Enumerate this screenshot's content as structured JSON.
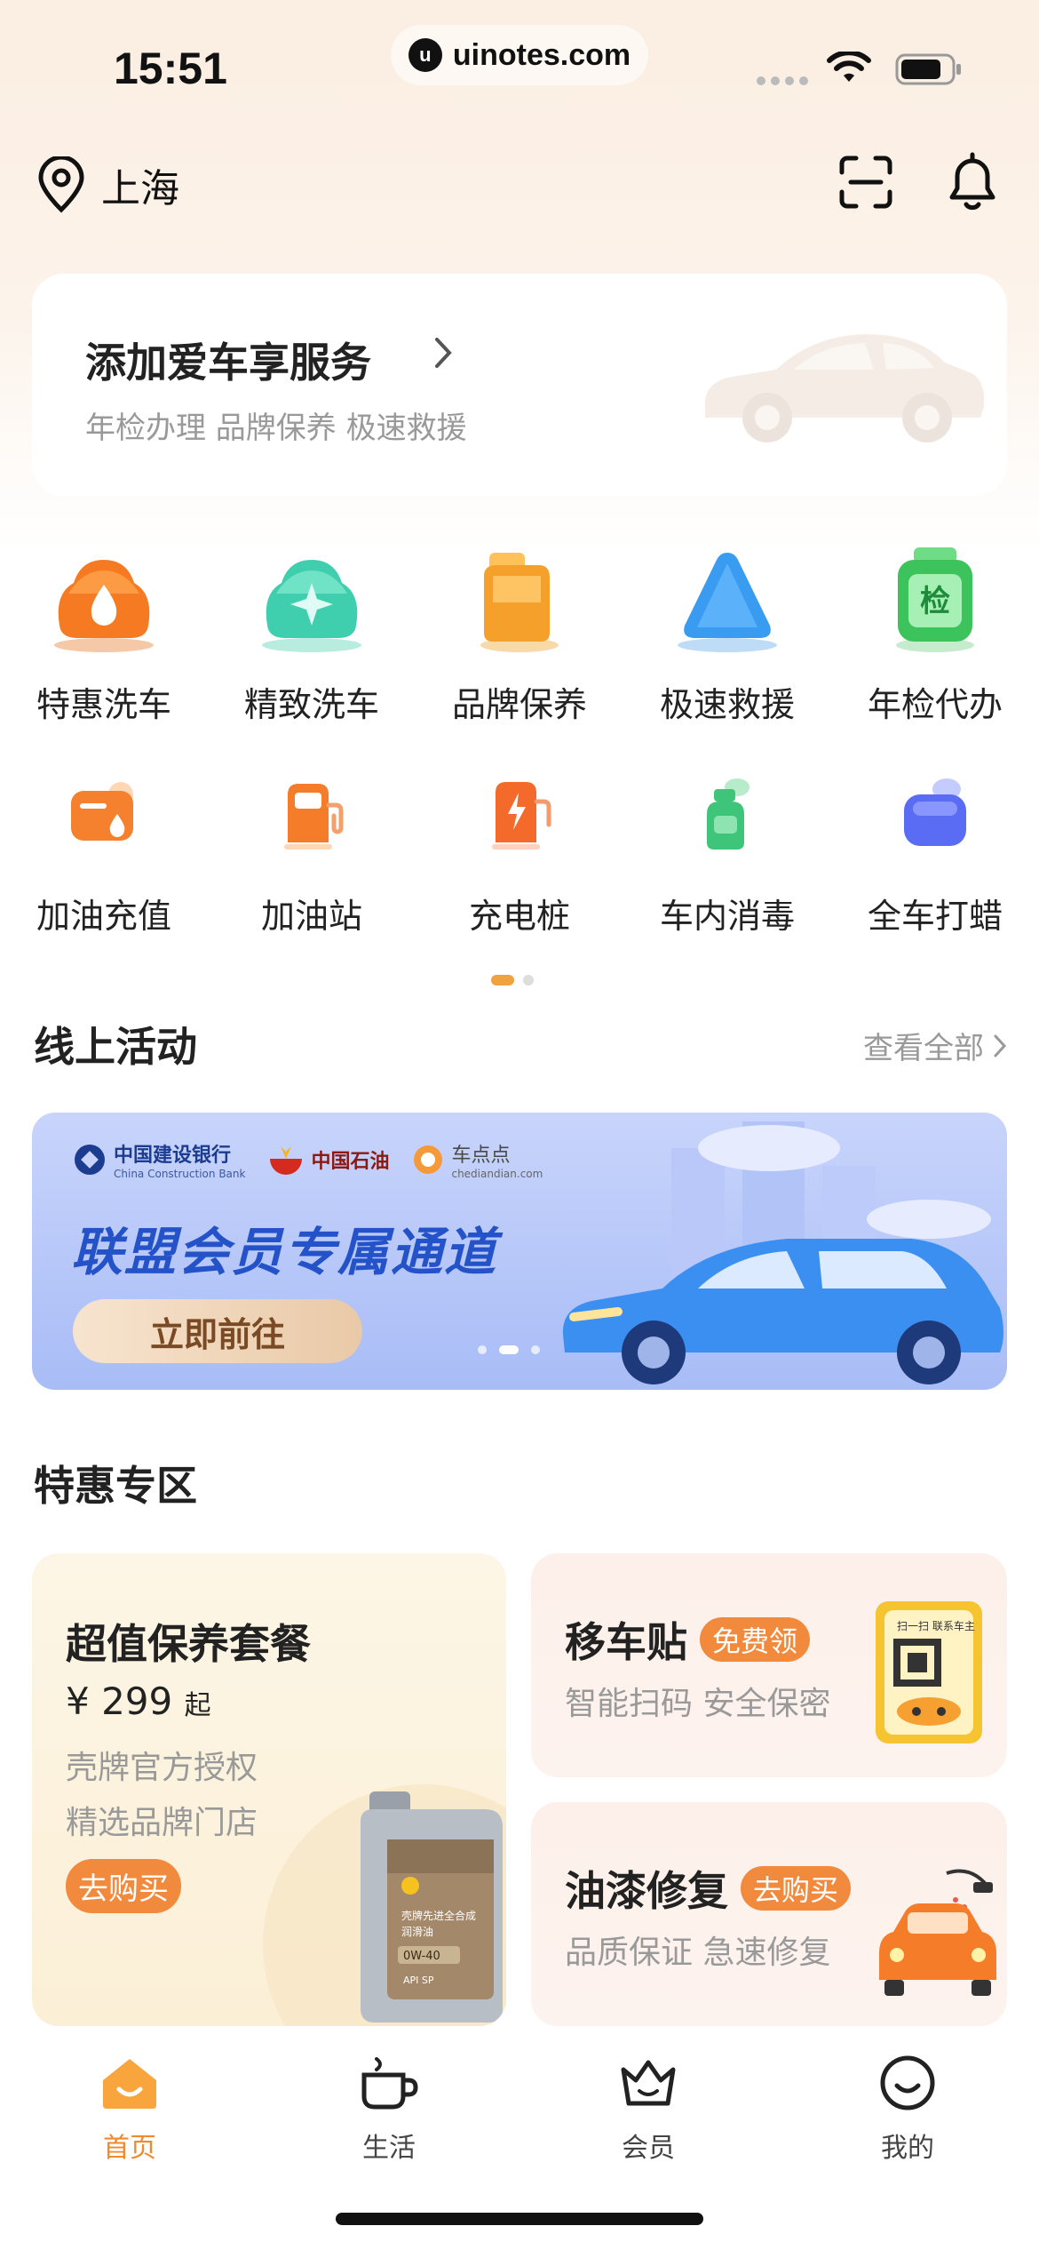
{
  "status_bar": {
    "time": "15:51",
    "url": "uinotes.com",
    "url_logo": "u"
  },
  "header": {
    "location": "上海",
    "icons": [
      "location-pin-icon",
      "scan-icon",
      "bell-icon"
    ]
  },
  "add_car": {
    "title": "添加爱车享服务",
    "subtitle": "年检办理 品牌保养 极速救援"
  },
  "services": {
    "row1": [
      {
        "label": "特惠洗车",
        "icon": "car-wash-drop-icon",
        "color": "#f57a22"
      },
      {
        "label": "精致洗车",
        "icon": "car-sparkle-icon",
        "color": "#3fcfae"
      },
      {
        "label": "品牌保养",
        "icon": "oil-can-icon",
        "color": "#f5a02a"
      },
      {
        "label": "极速救援",
        "icon": "warning-triangle-icon",
        "color": "#3a9cf0"
      },
      {
        "label": "年检代办",
        "icon": "inspection-badge-icon",
        "color": "#3cc35c",
        "badge": "检"
      }
    ],
    "row2": [
      {
        "label": "加油充值",
        "icon": "fuel-card-icon",
        "color": "#f5812e"
      },
      {
        "label": "加油站",
        "icon": "gas-pump-icon",
        "color": "#f57d2a"
      },
      {
        "label": "充电桩",
        "icon": "charging-pile-icon",
        "color": "#f36a2a"
      },
      {
        "label": "车内消毒",
        "icon": "disinfect-spray-icon",
        "color": "#3ec57a"
      },
      {
        "label": "全车打蜡",
        "icon": "wax-polish-icon",
        "color": "#5a6cf3"
      }
    ],
    "page": 1,
    "pages": 2
  },
  "online_activities": {
    "title": "线上活动",
    "see_all": "查看全部",
    "banner": {
      "logos": [
        {
          "name": "中国建设银行",
          "sub": "China Construction Bank"
        },
        {
          "name": "中国石油",
          "sub": ""
        },
        {
          "name": "车点点",
          "sub": "chediandian.com"
        }
      ],
      "headline": "联盟会员专属通道",
      "button": "立即前往",
      "active_slide": 2,
      "slides": 3
    }
  },
  "deals": {
    "title": "特惠专区",
    "maintenance": {
      "title": "超值保养套餐",
      "price": "¥ 299",
      "price_suffix": "起",
      "desc1": "壳牌官方授权",
      "desc2": "精选品牌门店",
      "button": "去购买",
      "product_label": "壳牌先进全合成润滑油 0W-40 API SP"
    },
    "move_sticker": {
      "title": "移车贴",
      "tag": "免费领",
      "desc": "智能扫码 安全保密",
      "card_text": "扫一扫 联系车主"
    },
    "paint": {
      "title": "油漆修复",
      "tag": "去购买",
      "desc": "品质保证 急速修复"
    }
  },
  "tabbar": [
    {
      "label": "首页",
      "icon": "home-icon",
      "active": true
    },
    {
      "label": "生活",
      "icon": "cup-icon",
      "active": false
    },
    {
      "label": "会员",
      "icon": "crown-icon",
      "active": false
    },
    {
      "label": "我的",
      "icon": "smile-icon",
      "active": false
    }
  ],
  "colors": {
    "accent": "#f08a2a",
    "banner_blue": "#2452c8"
  }
}
